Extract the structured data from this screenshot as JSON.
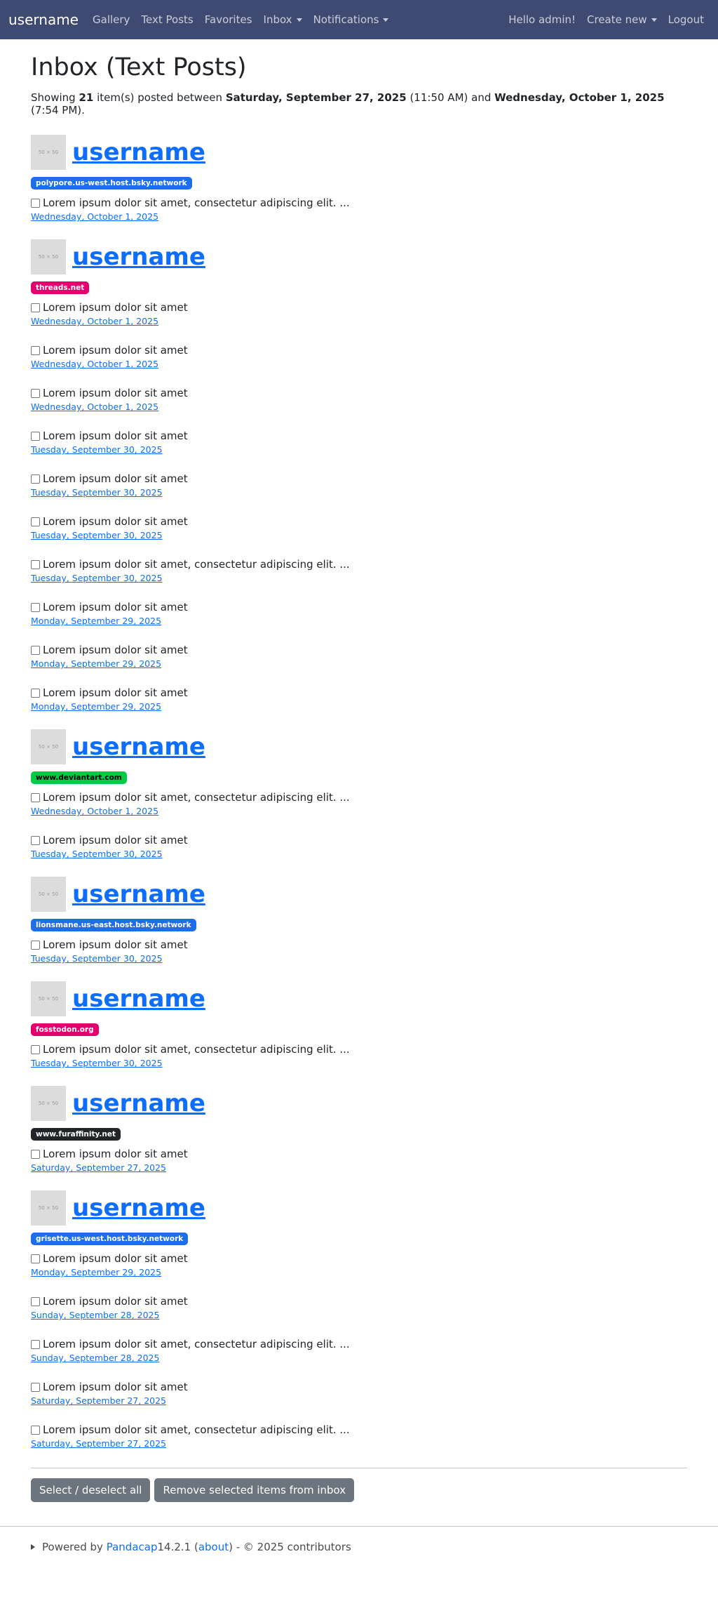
{
  "navbar": {
    "brand": "username",
    "links": [
      "Gallery",
      "Text Posts",
      "Favorites"
    ],
    "inbox": "Inbox",
    "notifications": "Notifications",
    "greeting": "Hello admin!",
    "create_new": "Create new",
    "logout": "Logout"
  },
  "page": {
    "title": "Inbox (Text Posts)",
    "summary_prefix": "Showing ",
    "count": "21",
    "summary_mid": " item(s) posted between ",
    "start_date": "Saturday, September 27, 2025",
    "start_time": " (11:50 AM) and ",
    "end_date": "Wednesday, October 1, 2025",
    "end_time": " (7:54 PM)."
  },
  "avatar_placeholder": "50 × 50",
  "groups": [
    {
      "username": "username",
      "badge": "polypore.us-west.host.bsky.network",
      "badge_class": "bsky",
      "posts": [
        {
          "text": "Lorem ipsum dolor sit amet, consectetur adipiscing elit. ...",
          "date": "Wednesday, October 1, 2025"
        }
      ]
    },
    {
      "username": "username",
      "badge": "threads.net",
      "badge_class": "threads",
      "posts": [
        {
          "text": "Lorem ipsum dolor sit amet",
          "date": "Wednesday, October 1, 2025"
        },
        {
          "text": "Lorem ipsum dolor sit amet",
          "date": "Wednesday, October 1, 2025"
        },
        {
          "text": "Lorem ipsum dolor sit amet",
          "date": "Wednesday, October 1, 2025"
        },
        {
          "text": "Lorem ipsum dolor sit amet",
          "date": "Tuesday, September 30, 2025"
        },
        {
          "text": "Lorem ipsum dolor sit amet",
          "date": "Tuesday, September 30, 2025"
        },
        {
          "text": "Lorem ipsum dolor sit amet",
          "date": "Tuesday, September 30, 2025"
        },
        {
          "text": "Lorem ipsum dolor sit amet, consectetur adipiscing elit. ...",
          "date": "Tuesday, September 30, 2025"
        },
        {
          "text": "Lorem ipsum dolor sit amet",
          "date": "Monday, September 29, 2025"
        },
        {
          "text": "Lorem ipsum dolor sit amet",
          "date": "Monday, September 29, 2025"
        },
        {
          "text": "Lorem ipsum dolor sit amet",
          "date": "Monday, September 29, 2025"
        }
      ]
    },
    {
      "username": "username",
      "badge": "www.deviantart.com",
      "badge_class": "deviantart",
      "posts": [
        {
          "text": "Lorem ipsum dolor sit amet, consectetur adipiscing elit. ...",
          "date": "Wednesday, October 1, 2025"
        },
        {
          "text": "Lorem ipsum dolor sit amet",
          "date": "Tuesday, September 30, 2025"
        }
      ]
    },
    {
      "username": "username",
      "badge": "lionsmane.us-east.host.bsky.network",
      "badge_class": "bsky",
      "posts": [
        {
          "text": "Lorem ipsum dolor sit amet",
          "date": "Tuesday, September 30, 2025"
        }
      ]
    },
    {
      "username": "username",
      "badge": "fosstodon.org",
      "badge_class": "fosstodon",
      "posts": [
        {
          "text": "Lorem ipsum dolor sit amet, consectetur adipiscing elit. ...",
          "date": "Tuesday, September 30, 2025"
        }
      ]
    },
    {
      "username": "username",
      "badge": "www.furaffinity.net",
      "badge_class": "furaffinity",
      "posts": [
        {
          "text": "Lorem ipsum dolor sit amet",
          "date": "Saturday, September 27, 2025"
        }
      ]
    },
    {
      "username": "username",
      "badge": "grisette.us-west.host.bsky.network",
      "badge_class": "bsky",
      "posts": [
        {
          "text": "Lorem ipsum dolor sit amet",
          "date": "Monday, September 29, 2025"
        },
        {
          "text": "Lorem ipsum dolor sit amet",
          "date": "Sunday, September 28, 2025"
        },
        {
          "text": "Lorem ipsum dolor sit amet, consectetur adipiscing elit. ...",
          "date": "Sunday, September 28, 2025"
        },
        {
          "text": "Lorem ipsum dolor sit amet",
          "date": "Saturday, September 27, 2025"
        },
        {
          "text": "Lorem ipsum dolor sit amet, consectetur adipiscing elit. ...",
          "date": "Saturday, September 27, 2025"
        }
      ]
    }
  ],
  "actions": {
    "select_all": "Select / deselect all",
    "remove": "Remove selected items from inbox"
  },
  "footer": {
    "powered_by": "Powered by ",
    "app_name": "Pandacap",
    "version": " 14.2.1 (",
    "about": "about",
    "copyright": ") - © 2025 contributors"
  }
}
